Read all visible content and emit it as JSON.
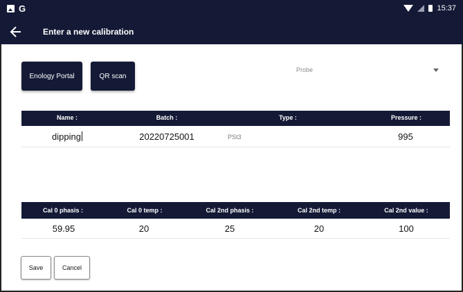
{
  "status_bar": {
    "app_letter": "G",
    "time": "15:37"
  },
  "header": {
    "title": "Enter a new calibration"
  },
  "actions": {
    "portal_label": "Enology Portal",
    "qr_label": "QR scan"
  },
  "probe_select": {
    "selected": "Probe"
  },
  "table1": {
    "headers": [
      "Name :",
      "Batch :",
      "Type :",
      "Pressure :"
    ],
    "row": {
      "name": "dipping",
      "batch": "20220725001",
      "type": "PSt3",
      "pressure": "995"
    }
  },
  "table2": {
    "headers": [
      "Cal 0 phasis :",
      "Cal 0 temp :",
      "Cal 2nd phasis :",
      "Cal 2nd temp :",
      "Cal 2nd value :"
    ],
    "values": [
      "59.95",
      "20",
      "25",
      "20",
      "100"
    ]
  },
  "footer": {
    "save_label": "Save",
    "cancel_label": "Cancel"
  }
}
